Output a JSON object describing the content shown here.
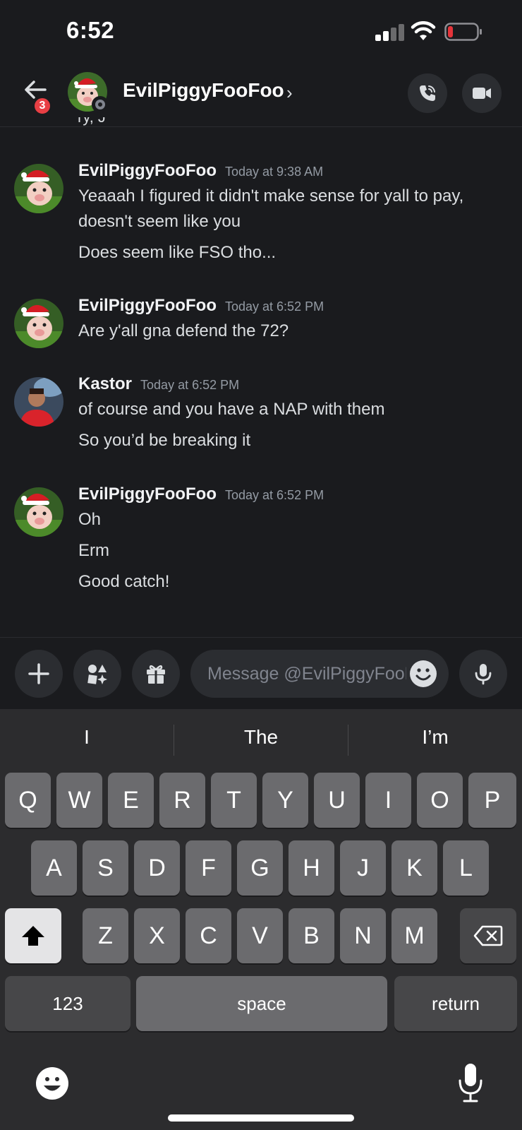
{
  "status_bar": {
    "time": "6:52"
  },
  "header": {
    "back_badge": "3",
    "title": "EvilPiggyFooFoo",
    "chevron": "›"
  },
  "cut_off_text": "ry, J",
  "messages": [
    {
      "author": "EvilPiggyFooFoo",
      "timestamp": "Today at 9:38 AM",
      "avatar": "pig-avatar",
      "lines": [
        "Yeaaah I figured it didn't make sense for yall to pay,",
        "doesn't seem like you",
        "Does seem like FSO tho..."
      ]
    },
    {
      "author": "EvilPiggyFooFoo",
      "timestamp": "Today at 6:52 PM",
      "avatar": "pig-avatar",
      "lines": [
        "Are y'all gna defend the 72?"
      ]
    },
    {
      "author": "Kastor",
      "timestamp": "Today at 6:52 PM",
      "avatar": "kastor-avatar",
      "lines": [
        "of course and you have a NAP with them",
        "So you’d be breaking it"
      ]
    },
    {
      "author": "EvilPiggyFooFoo",
      "timestamp": "Today at 6:52 PM",
      "avatar": "pig-avatar",
      "lines": [
        "Oh",
        "Erm",
        "Good catch!"
      ]
    }
  ],
  "composer": {
    "placeholder": "Message @EvilPiggyFooFoo"
  },
  "keyboard": {
    "suggestions": [
      "I",
      "The",
      "I’m"
    ],
    "row1": [
      "Q",
      "W",
      "E",
      "R",
      "T",
      "Y",
      "U",
      "I",
      "O",
      "P"
    ],
    "row2": [
      "A",
      "S",
      "D",
      "F",
      "G",
      "H",
      "J",
      "K",
      "L"
    ],
    "row3": [
      "Z",
      "X",
      "C",
      "V",
      "B",
      "N",
      "M"
    ],
    "numbers_label": "123",
    "space_label": "space",
    "return_label": "return"
  },
  "colors": {
    "background": "#1a1b1e",
    "badge": "#e83f44",
    "battery_low": "#e5343a",
    "muted_text": "#949ba4"
  }
}
